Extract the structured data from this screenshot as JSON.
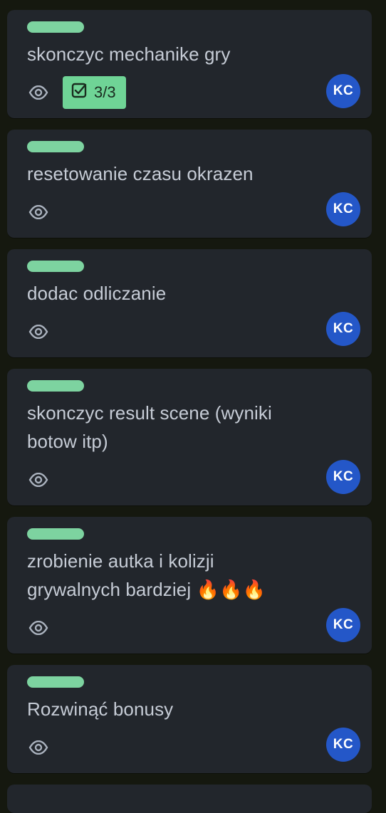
{
  "accent_colors": {
    "label": "#7dd3a0",
    "checklist_complete": "#6fd496",
    "avatar": "#2457c8"
  },
  "cards": [
    {
      "title": "skonczyc mechanike gry",
      "watch_icon": "eye-icon",
      "checklist": {
        "icon": "checkbox-icon",
        "text": "3/3"
      },
      "member": "KC"
    },
    {
      "title": "resetowanie czasu okrazen",
      "watch_icon": "eye-icon",
      "member": "KC"
    },
    {
      "title": "dodac odliczanie",
      "watch_icon": "eye-icon",
      "member": "KC"
    },
    {
      "title": "skonczyc result scene (wyniki botow itp)",
      "watch_icon": "eye-icon",
      "member": "KC"
    },
    {
      "title": "zrobienie autka i kolizji grywalnych bardziej 🔥🔥🔥",
      "watch_icon": "eye-icon",
      "member": "KC"
    },
    {
      "title": "Rozwinąć bonusy",
      "watch_icon": "eye-icon",
      "member": "KC"
    }
  ]
}
